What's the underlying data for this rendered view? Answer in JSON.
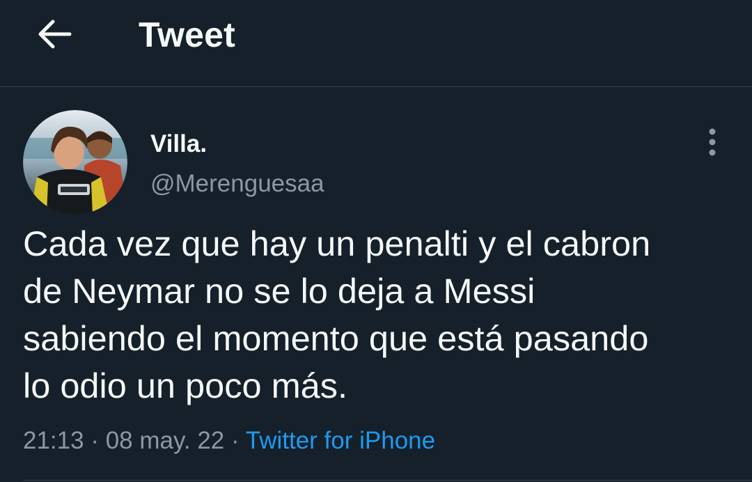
{
  "header": {
    "back_icon": "arrow-left-icon",
    "title": "Tweet"
  },
  "tweet": {
    "author": {
      "display_name": "Villa.",
      "handle": "@Merenguesaa",
      "avatar": "avatar-photo"
    },
    "more_icon": "more-vertical-icon",
    "text_lines": [
      "Cada vez que hay un penalti y el cabron",
      "de Neymar no se lo deja a Messi",
      "sabiendo el momento que está pasando",
      "lo odio un poco más."
    ],
    "time": "21:13",
    "date": "08 may. 22",
    "separator": "·",
    "source": "Twitter for iPhone"
  },
  "colors": {
    "background": "#15202b",
    "text": "#f7f9f9",
    "secondary": "#8b98a5",
    "accent": "#1d9bf0",
    "divider": "#38444d"
  }
}
